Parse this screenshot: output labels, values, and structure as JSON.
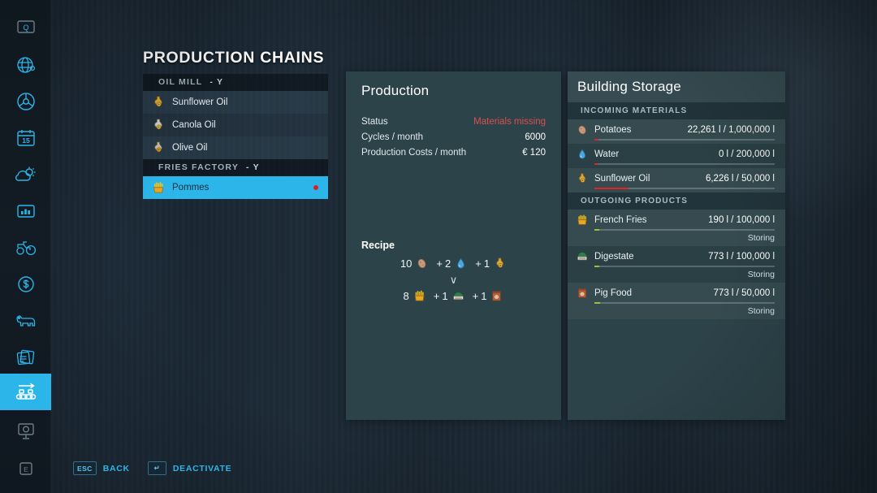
{
  "page": {
    "title": "PRODUCTION CHAINS"
  },
  "sidebar": {
    "active_index": 10,
    "accent": "#2cb5e8",
    "items": [
      {
        "icon": "map-overview-icon",
        "label": "Map Overview"
      },
      {
        "icon": "globe-icon",
        "label": "Globe"
      },
      {
        "icon": "steering-wheel-icon",
        "label": "Vehicles"
      },
      {
        "icon": "calendar-15-icon",
        "label": "Calendar"
      },
      {
        "icon": "weather-icon",
        "label": "Weather"
      },
      {
        "icon": "statistics-icon",
        "label": "Statistics"
      },
      {
        "icon": "tractor-icon",
        "label": "Vehicle Overview"
      },
      {
        "icon": "dollar-coin-icon",
        "label": "Finances"
      },
      {
        "icon": "cow-icon",
        "label": "Animals"
      },
      {
        "icon": "contracts-icon",
        "label": "Contracts"
      },
      {
        "icon": "conveyor-icon",
        "label": "Production Chains"
      },
      {
        "icon": "presentation-icon",
        "label": "Help"
      },
      {
        "icon": "e-key-icon",
        "label": "Exit"
      }
    ]
  },
  "chains": {
    "groups": [
      {
        "name": "OIL MILL",
        "key": "-  Y",
        "items": [
          {
            "label": "Sunflower Oil",
            "icon": "oil-bottle-icon",
            "selected": false,
            "alert": false
          },
          {
            "label": "Canola Oil",
            "icon": "oil-bottle-icon",
            "selected": false,
            "alert": false
          },
          {
            "label": "Olive Oil",
            "icon": "oil-bottle-icon",
            "selected": false,
            "alert": false
          }
        ]
      },
      {
        "name": "FRIES FACTORY",
        "key": "-  Y",
        "items": [
          {
            "label": "Pommes",
            "icon": "french-fries-icon",
            "selected": true,
            "alert": true
          }
        ]
      }
    ]
  },
  "production": {
    "title": "Production",
    "stats": [
      {
        "label": "Status",
        "value": "Materials missing",
        "alert": true
      },
      {
        "label": "Cycles / month",
        "value": "6000",
        "alert": false
      },
      {
        "label": "Production Costs / month",
        "value": "€ 120",
        "alert": false
      }
    ],
    "recipe_heading": "Recipe",
    "recipe": {
      "inputs": [
        {
          "amount": "10",
          "icon": "potato-icon",
          "name": "Potatoes"
        },
        {
          "amount": "2",
          "icon": "water-drop-icon",
          "name": "Water"
        },
        {
          "amount": "1",
          "icon": "oil-bottle-icon",
          "name": "Sunflower Oil"
        }
      ],
      "arrow": "∨",
      "outputs": [
        {
          "amount": "8",
          "icon": "french-fries-icon",
          "name": "French Fries"
        },
        {
          "amount": "1",
          "icon": "digestate-icon",
          "name": "Digestate"
        },
        {
          "amount": "1",
          "icon": "pig-food-icon",
          "name": "Pig Food"
        }
      ]
    },
    "alert_color": "#d9504e"
  },
  "storage": {
    "title": "Building Storage",
    "sections": [
      {
        "heading": "INCOMING MATERIALS",
        "bar_color": "#e0242c",
        "rows": [
          {
            "name": "Potatoes",
            "icon": "potato-icon",
            "amount": "22,261 l / 1,000,000 l",
            "fill_pct": 2.2,
            "status": ""
          },
          {
            "name": "Water",
            "icon": "water-drop-icon",
            "amount": "0 l / 200,000 l",
            "fill_pct": 1.0,
            "status": ""
          },
          {
            "name": "Sunflower Oil",
            "icon": "oil-bottle-icon",
            "amount": "6,226 l / 50,000 l",
            "fill_pct": 12.5,
            "status": ""
          }
        ]
      },
      {
        "heading": "OUTGOING PRODUCTS",
        "bar_color": "#8dc53e",
        "rows": [
          {
            "name": "French Fries",
            "icon": "french-fries-icon",
            "amount": "190 l / 100,000 l",
            "fill_pct": 1.5,
            "status": "Storing"
          },
          {
            "name": "Digestate",
            "icon": "digestate-icon",
            "amount": "773 l / 100,000 l",
            "fill_pct": 2.0,
            "status": "Storing"
          },
          {
            "name": "Pig Food",
            "icon": "pig-food-icon",
            "amount": "773 l / 50,000 l",
            "fill_pct": 2.5,
            "status": "Storing"
          }
        ]
      }
    ]
  },
  "help_bar": {
    "hints": [
      {
        "key": "ESC",
        "icon": "esc-key-icon",
        "label": "BACK"
      },
      {
        "key": "↵",
        "icon": "enter-key-icon",
        "label": "DEACTIVATE"
      }
    ]
  }
}
